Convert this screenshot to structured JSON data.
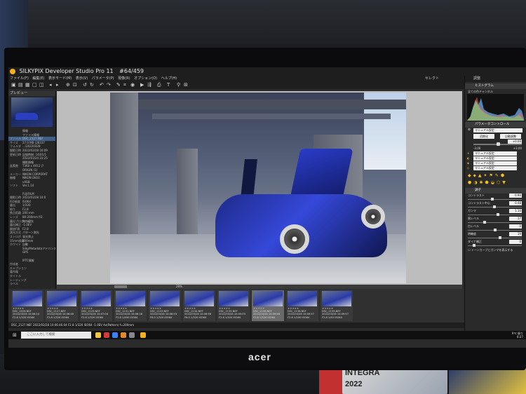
{
  "window": {
    "title": "SILKYPIX Developer Studio Pro 11",
    "counter": "#64/459"
  },
  "menu": [
    "ファイル(F)",
    "編集(E)",
    "表示モード(M)",
    "表示(V)",
    "パラメータ(P)",
    "現像(R)",
    "オプション(O)",
    "ヘルプ(H)"
  ],
  "toolbar": {
    "select_label": "セレクト"
  },
  "left_panel": {
    "header": "プレビュー",
    "info": [
      {
        "k": "",
        "v": "情報"
      },
      {
        "k": "",
        "v": "ファイル情報"
      },
      {
        "k": "ファイル",
        "v": "DSC_2127.NEF"
      },
      {
        "k": "サイズ",
        "v": "27.0 MB (28337"
      },
      {
        "k": "フォルダ",
        "v": "...\\20220328"
      },
      {
        "k": "撮影日時",
        "v": "2022/03/28 16:09"
      },
      {
        "k": "更新日時",
        "v": "記録時刻: 14/01/1"
      },
      {
        "k": "",
        "v": "2022/03/24 23:25"
      },
      {
        "k": "",
        "v": "撮影情報"
      },
      {
        "k": "画素数",
        "v": "7360 x 4912 (?"
      },
      {
        "k": "",
        "v": "ORIGIN (1)"
      },
      {
        "k": "メーカー",
        "v": "NIKON CORPORAT"
      },
      {
        "k": "機種",
        "v": "NIKON D810"
      },
      {
        "k": "",
        "v": "v4G8"
      },
      {
        "k": "ソフト",
        "v": "Ver.1.14"
      },
      {
        "k": "",
        "v": ""
      },
      {
        "k": "",
        "v": "FUJIFILM"
      },
      {
        "k": "撮影日時",
        "v": "2022/03/28 10:0"
      },
      {
        "k": "ISO感度",
        "v": "ISO64"
      },
      {
        "k": "露出",
        "v": "1/320"
      },
      {
        "k": "絞り",
        "v": "F2.8"
      },
      {
        "k": "焦点距離",
        "v": "200 mm"
      },
      {
        "k": "レンズ",
        "v": "80-200mm f/2."
      },
      {
        "k": "露出プログラム",
        "v": "絞り優先"
      },
      {
        "k": "露出補正",
        "v": "-1.0EV"
      },
      {
        "k": "開放F値",
        "v": "F2.8"
      },
      {
        "k": "測光方式",
        "v": "パターン測光"
      },
      {
        "k": "ストロボ",
        "v": "発光禁止"
      },
      {
        "k": "35mm換算",
        "v": "200mm"
      },
      {
        "k": "ホワイト",
        "v": "自動"
      },
      {
        "k": "",
        "v": "SilkyMetadataアドバンス"
      },
      {
        "k": "",
        "v": "GPS"
      },
      {
        "k": "",
        "v": ""
      },
      {
        "k": "",
        "v": "IPTC情報"
      },
      {
        "k": "作成者",
        "v": ""
      },
      {
        "k": "キャプション",
        "v": ""
      },
      {
        "k": "著作権",
        "v": ""
      },
      {
        "k": "タイトル",
        "v": ""
      },
      {
        "k": "レーティング",
        "v": ""
      },
      {
        "k": "ラベル",
        "v": ""
      }
    ]
  },
  "filmstrip": {
    "scroll_label": "28%",
    "items": [
      {
        "name": "DSC_2026.NEF",
        "date": "2022/03/28 10:06:24",
        "exif": "F2.8 1/320 ISO64"
      },
      {
        "name": "DSC_2127.NEF",
        "date": "2022/03/28 10:06:46",
        "exif": "F2.8 1/320 ISO64"
      },
      {
        "name": "DSC_2129.NEF",
        "date": "2022/03/28 10:07:04",
        "exif": "F2.8 1/320 ISO64"
      },
      {
        "name": "DSC_2131.NEF",
        "date": "2022/03/28 10:08:18",
        "exif": "F2.8 1/400 ISO64"
      },
      {
        "name": "DSC_2133.NEF",
        "date": "2022/03/28 10:08:53",
        "exif": "F6.0 1/320 ISO64"
      },
      {
        "name": "DSC_2134.NEF",
        "date": "2022/03/28 10:08:58",
        "exif": "F8.0 1/320 ISO64"
      },
      {
        "name": "DSC_2135.NEF",
        "date": "2022/03/28 10:09:03",
        "exif": "F2.8 1/320 ISO64"
      },
      {
        "name": "DSC_2136.NEF",
        "date": "2022/03/28 10:09:46",
        "exif": "F2.8 1/320 ISO64"
      },
      {
        "name": "DSC_2138.NEF",
        "date": "2022/03/28 10:09:57",
        "exif": "F2.8 1/200 ISO64"
      },
      {
        "name": "DSC_2139.NEF",
        "date": "2022/03/28 10:09:57",
        "exif": "F2.8 1/40 ISO64"
      }
    ],
    "selected_index": 7
  },
  "status": "DSC_2127.NEF 2022/03/28 10:06:46.04 F2.8 1/320 ISO64 -1.0EV Av(Pattern) f=200mm",
  "taskbar": {
    "search_placeholder": "ここに入力して検索",
    "tray_lines": [
      "9℃ 曇り",
      "8:27",
      "2022/03/28"
    ]
  },
  "right_panel": {
    "tab": "調整",
    "histogram_title": "ヒストグラム",
    "histogram_channel": "全ての色チャンネル",
    "param_control_title": "パラメータコントロール",
    "preset": "マニュアル設定",
    "btn_initial": "初期化",
    "btn_auto": "自動調整",
    "exposure": {
      "value": "+0.00",
      "min": "-3.00",
      "max": "+3.00",
      "level": 0.5
    },
    "presets": [
      "マニュアル設定",
      "マニュアル設定",
      "マニュアル設定",
      "マニュアル設定"
    ],
    "tone_title": "調子",
    "params": [
      {
        "label": "コントラスト",
        "value": "0.90",
        "level": 0.45
      },
      {
        "label": "コントラスト中心",
        "value": "0.48",
        "level": 0.48
      },
      {
        "label": "ガンマ",
        "value": "1.10",
        "level": 0.55
      },
      {
        "label": "黒レベル",
        "value": "17",
        "level": 0.3
      },
      {
        "label": "白レベル",
        "value": "0",
        "level": 0.5
      },
      {
        "label": "明瞭度",
        "value": "19",
        "level": 0.6
      },
      {
        "label": "ダイナ補正",
        "value": "0",
        "level": 0.1
      }
    ],
    "checkbox_label": "トーンカーブとガンマを表示する"
  },
  "surroundings": {
    "monitor_brand": "acer",
    "box_text": "INTEGRA",
    "box_year": "2022"
  },
  "colors": {
    "accent_selected": "#3d5f8a",
    "app_icon": "#f0b020",
    "panel": "#2a2a2a"
  }
}
